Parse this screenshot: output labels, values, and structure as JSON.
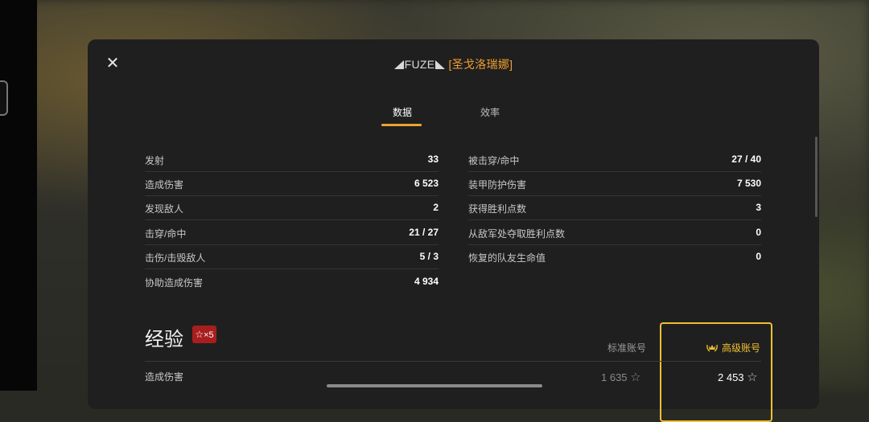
{
  "header": {
    "player_name": "FUZE",
    "clan_tag": "[圣戈洛瑞娜]"
  },
  "tabs": [
    {
      "label": "数据",
      "active": true
    },
    {
      "label": "效率",
      "active": false
    }
  ],
  "stats_left": [
    {
      "label": "发射",
      "value": "33"
    },
    {
      "label": "造成伤害",
      "value": "6 523"
    },
    {
      "label": "发现敌人",
      "value": "2"
    },
    {
      "label": "击穿/命中",
      "value": "21 / 27"
    },
    {
      "label": "击伤/击毁敌人",
      "value": "5 / 3"
    },
    {
      "label": "协助造成伤害",
      "value": "4 934"
    }
  ],
  "stats_right": [
    {
      "label": "被击穿/命中",
      "value": "27 / 40"
    },
    {
      "label": "装甲防护伤害",
      "value": "7 530"
    },
    {
      "label": "获得胜利点数",
      "value": "3"
    },
    {
      "label": "从敌军处夺取胜利点数",
      "value": "0"
    },
    {
      "label": "恢复的队友生命值",
      "value": "0"
    }
  ],
  "experience": {
    "title": "经验",
    "multiplier_badge": "×5",
    "standard_label": "标准账号",
    "premium_label": "高级账号",
    "rows": [
      {
        "label": "造成伤害",
        "standard": "1 635",
        "premium": "2 453"
      }
    ]
  },
  "colors": {
    "accent_orange": "#f0a032",
    "premium_gold": "#f0c030",
    "badge_red": "#a81e1e",
    "panel_bg": "#1f1f1f"
  },
  "icons": {
    "close": "close-icon",
    "star": "star-icon",
    "premium": "crown-laurel-icon"
  }
}
